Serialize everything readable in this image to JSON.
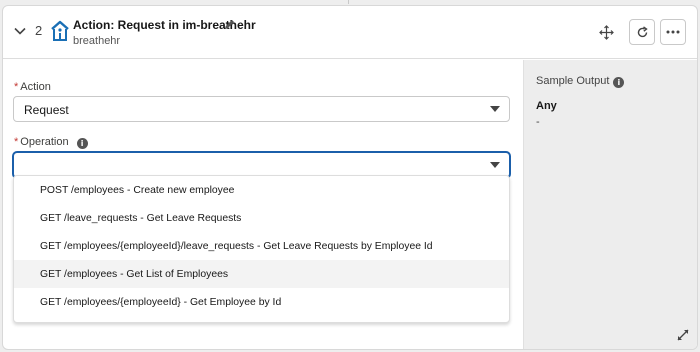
{
  "header": {
    "step_number": "2",
    "title": "Action: Request in im-breathehr",
    "subtitle": "breathehr"
  },
  "form": {
    "action_label": "Action",
    "action_value": "Request",
    "operation_label": "Operation",
    "operation_value": ""
  },
  "dropdown": {
    "options": [
      "POST /employees - Create new employee",
      "GET /leave_requests - Get Leave Requests",
      "GET /employees/{employeeId}/leave_requests - Get Leave Requests by Employee Id",
      "GET /employees - Get List of Employees",
      "GET /employees/{employeeId} - Get Employee by Id"
    ],
    "highlighted_index": 3
  },
  "output": {
    "title": "Sample Output",
    "type": "Any",
    "value": "-"
  },
  "colors": {
    "accent": "#1b5faa",
    "required": "#c23934",
    "logo": "#1a6fb5"
  }
}
